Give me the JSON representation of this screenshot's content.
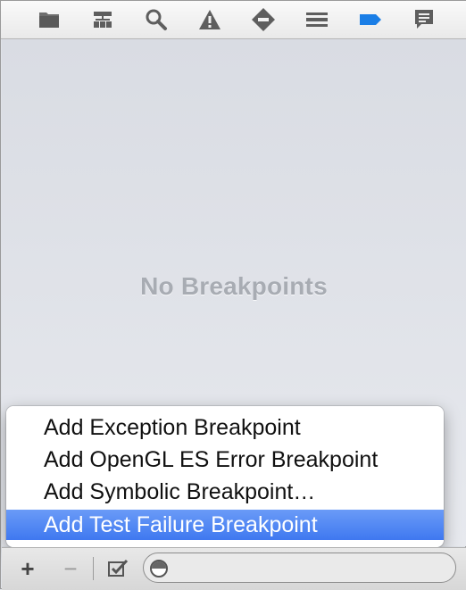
{
  "toolbar": {
    "icons": [
      "project-navigator-icon",
      "symbol-navigator-icon",
      "find-navigator-icon",
      "issue-navigator-icon",
      "test-navigator-icon",
      "debug-navigator-icon",
      "breakpoint-navigator-icon",
      "report-navigator-icon"
    ],
    "active_icon": "breakpoint-navigator-icon",
    "accent_color": "#1a7ee6"
  },
  "navigator": {
    "empty_message": "No Breakpoints"
  },
  "menu": {
    "items": [
      {
        "label": "Add Exception Breakpoint"
      },
      {
        "label": "Add OpenGL ES Error Breakpoint"
      },
      {
        "label": "Add Symbolic Breakpoint…"
      },
      {
        "label": "Add Test Failure Breakpoint"
      }
    ],
    "selected_label": "Add Test Failure Breakpoint",
    "highlight_color": "#3f78f0"
  },
  "bottombar": {
    "add_label": "+",
    "remove_label": "−",
    "filter_placeholder": ""
  }
}
